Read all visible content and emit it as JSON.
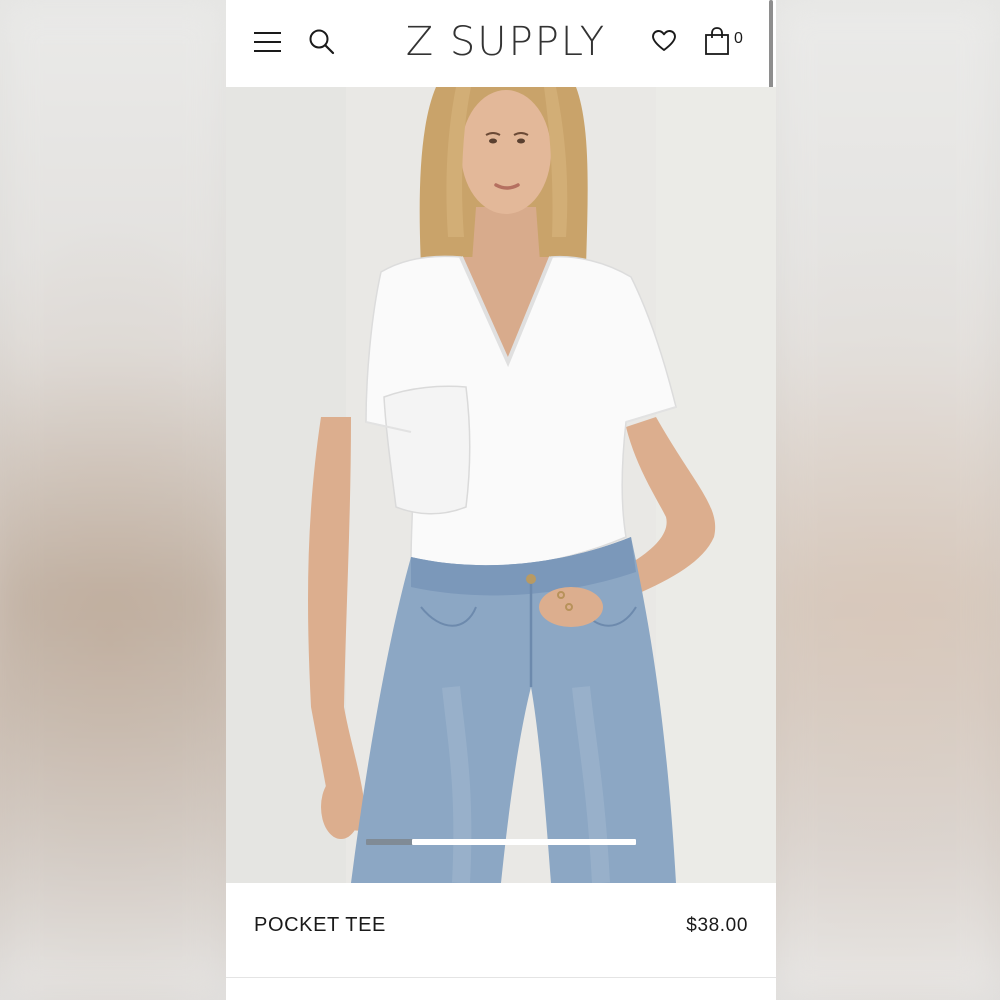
{
  "header": {
    "brand": "Z SUPPLY",
    "cart_count": "0",
    "icons": [
      "menu-icon",
      "search-icon",
      "heart-icon",
      "shopping-bag-icon"
    ]
  },
  "hero": {
    "alt_subject": "model wearing white v-neck pocket tee and light wash jeans",
    "slide_progress": 0.17
  },
  "product": {
    "name": "POCKET TEE",
    "price": "$38.00"
  },
  "below_fold": {
    "peek_text": "..."
  },
  "colors": {
    "background": "#ffffff",
    "text": "#1a1a1a",
    "brand": "#333333"
  }
}
